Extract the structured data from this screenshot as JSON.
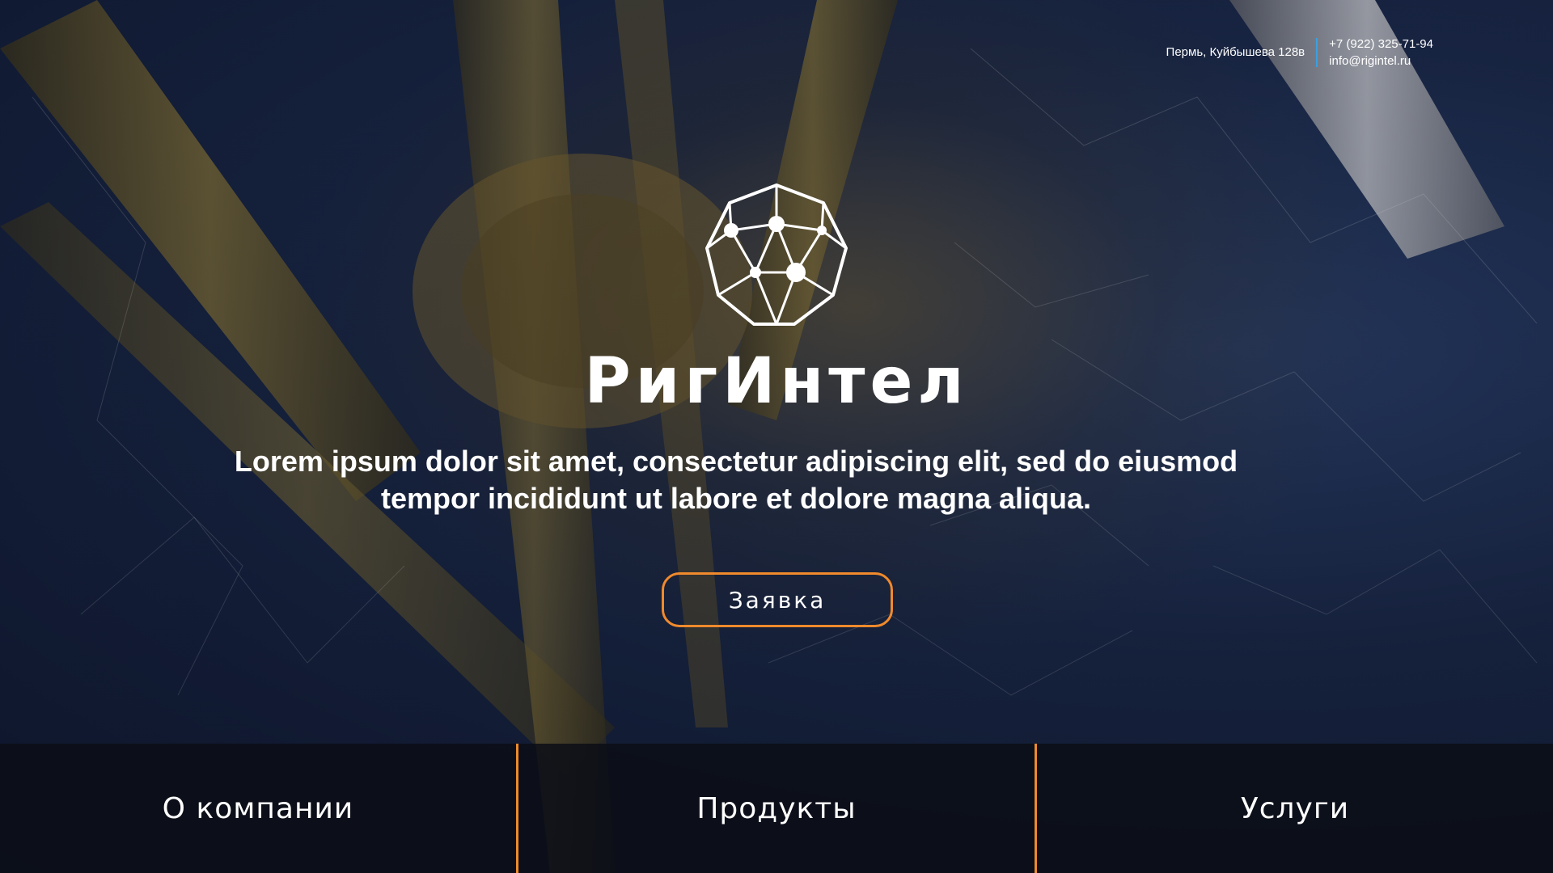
{
  "header": {
    "address": "Пермь, Куйбышева 128в",
    "phone": "+7 (922) 325-71-94",
    "email": "info@rigintel.ru"
  },
  "brand": {
    "name": "РигИнтел"
  },
  "hero": {
    "tagline_line1": "Lorem ipsum dolor sit amet, consectetur adipiscing elit, sed do eiusmod",
    "tagline_line2": "tempor incididunt ut labore et dolore magna aliqua.",
    "cta_label": "Заявка"
  },
  "nav": {
    "items": [
      {
        "label": "О компании"
      },
      {
        "label": "Продукты"
      },
      {
        "label": "Услуги"
      }
    ]
  },
  "colors": {
    "accent_orange": "#f08a2c",
    "divider_blue": "#3aa0e0",
    "sea_blue": "#1a2848"
  },
  "icons": {
    "logo": "network-polygon-icon"
  }
}
